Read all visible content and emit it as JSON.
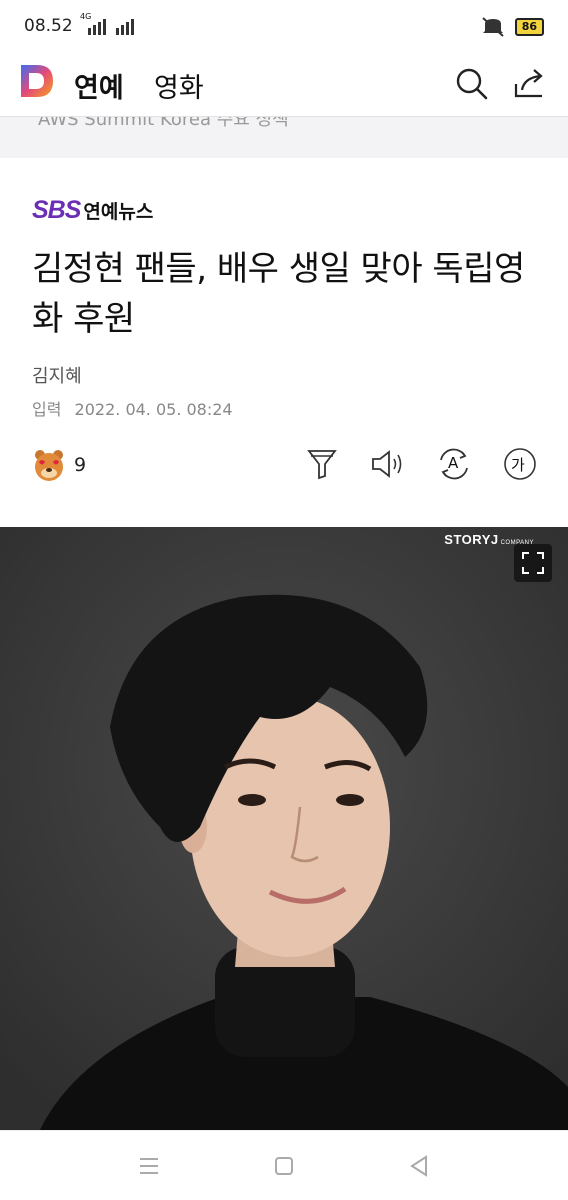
{
  "status_bar": {
    "time": "08.52",
    "network": "4G",
    "battery": "86",
    "icons": [
      "signal-icon",
      "mute-icon",
      "battery-icon"
    ]
  },
  "app_bar": {
    "logo": "daum-logo",
    "tab_active": "연예",
    "tab_inactive": "영화",
    "icons": [
      "search-icon",
      "share-icon"
    ]
  },
  "prev_article_strip": "AWS Summit Korea 주요 정책",
  "article": {
    "press_logo": "SBS",
    "press_sub": "연예뉴스",
    "headline": "김정현 팬들, 배우 생일 맞아 독립영화 후원",
    "author": "김지혜",
    "date_label": "입력",
    "date_value": "2022. 04. 05. 08:24",
    "reaction_count": "9",
    "tools": [
      "summary-filter-icon",
      "listen-icon",
      "translate-icon",
      "font-size-icon"
    ],
    "font_size_glyph": "가",
    "translate_glyph": "A"
  },
  "photo": {
    "credit": "STORYJ",
    "credit_small": "COMPANY"
  },
  "colors": {
    "brand_purple": "#6b2fb5",
    "battery_yellow": "#f2d53c"
  }
}
